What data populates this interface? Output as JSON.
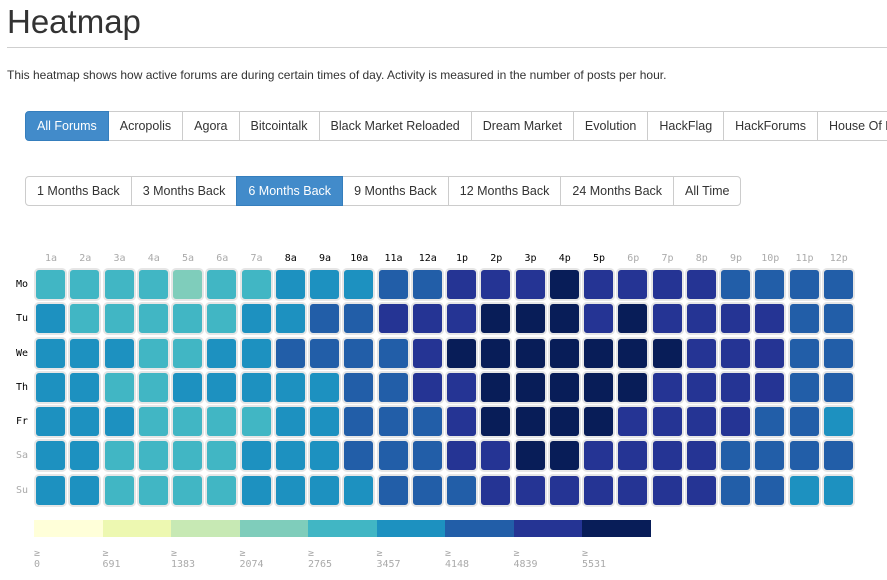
{
  "page": {
    "title": "Heatmap",
    "description": "This heatmap shows how active forums are during certain times of day. Activity is measured in the number of posts per hour."
  },
  "forum_tabs": {
    "active": "All Forums",
    "items": [
      "All Forums",
      "Acropolis",
      "Agora",
      "Bitcointalk",
      "Black Market Reloaded",
      "Dream Market",
      "Evolution",
      "HackFlag",
      "HackForums",
      "House Of Lions",
      ""
    ]
  },
  "range_tabs": {
    "active": "6 Months Back",
    "items": [
      "1 Months Back",
      "3 Months Back",
      "6 Months Back",
      "9 Months Back",
      "12 Months Back",
      "24 Months Back",
      "All Time"
    ]
  },
  "colors": {
    "active_button": "#428bca",
    "scale": [
      "#ffffd9",
      "#edf8b1",
      "#c7e9b4",
      "#7fcdbb",
      "#41b6c4",
      "#1d91c0",
      "#225ea8",
      "#253494",
      "#081d58"
    ]
  },
  "chart_data": {
    "type": "heatmap",
    "title": "",
    "value_label": "posts per hour",
    "x_categories": [
      "1a",
      "2a",
      "3a",
      "4a",
      "5a",
      "6a",
      "7a",
      "8a",
      "9a",
      "10a",
      "11a",
      "12a",
      "1p",
      "2p",
      "3p",
      "4p",
      "5p",
      "6p",
      "7p",
      "8p",
      "9p",
      "10p",
      "11p",
      "12p"
    ],
    "x_highlighted": [
      "8a",
      "9a",
      "10a",
      "11a",
      "12a",
      "1p",
      "2p",
      "3p",
      "4p",
      "5p"
    ],
    "y_categories": [
      "Mo",
      "Tu",
      "We",
      "Th",
      "Fr",
      "Sa",
      "Su"
    ],
    "y_highlighted": [
      "Mo",
      "Tu",
      "We",
      "Th",
      "Fr"
    ],
    "legend": {
      "thresholds": [
        0,
        691,
        1383,
        2074,
        2765,
        3457,
        4148,
        4839,
        5531
      ],
      "labels": [
        "≥ 0",
        "≥ 691",
        "≥ 1383",
        "≥ 2074",
        "≥ 2765",
        "≥ 3457",
        "≥ 4148",
        "≥ 4839",
        "≥ 5531"
      ],
      "placement": "bottom-left"
    },
    "bin_note": "values given as lower bound of the legend bin each cell falls into",
    "values": [
      [
        2765,
        2765,
        2765,
        2765,
        2074,
        2765,
        2765,
        3457,
        3457,
        3457,
        4148,
        4148,
        4839,
        4839,
        4839,
        5531,
        4839,
        4839,
        4839,
        4839,
        4148,
        4148,
        4148,
        4148
      ],
      [
        3457,
        2765,
        2765,
        2765,
        2765,
        2765,
        3457,
        3457,
        4148,
        4148,
        4839,
        4839,
        4839,
        5531,
        5531,
        5531,
        4839,
        5531,
        4839,
        4839,
        4839,
        4839,
        4148,
        4148
      ],
      [
        3457,
        3457,
        3457,
        2765,
        2765,
        3457,
        3457,
        4148,
        4148,
        4148,
        4148,
        4839,
        5531,
        5531,
        5531,
        5531,
        5531,
        5531,
        5531,
        4839,
        4839,
        4839,
        4148,
        4148
      ],
      [
        3457,
        3457,
        2765,
        2765,
        3457,
        3457,
        3457,
        3457,
        3457,
        4148,
        4148,
        4839,
        4839,
        5531,
        5531,
        5531,
        5531,
        5531,
        4839,
        4839,
        4839,
        4839,
        4148,
        4148
      ],
      [
        3457,
        3457,
        3457,
        2765,
        2765,
        2765,
        2765,
        3457,
        3457,
        4148,
        4148,
        4148,
        4839,
        5531,
        5531,
        5531,
        5531,
        4839,
        4839,
        4839,
        4839,
        4148,
        4148,
        3457
      ],
      [
        3457,
        3457,
        2765,
        2765,
        2765,
        2765,
        3457,
        3457,
        3457,
        4148,
        4148,
        4148,
        4839,
        4839,
        5531,
        5531,
        4839,
        4839,
        4839,
        4839,
        4148,
        4148,
        4148,
        4148
      ],
      [
        3457,
        3457,
        2765,
        2765,
        2765,
        2765,
        3457,
        3457,
        3457,
        3457,
        4148,
        4148,
        4148,
        4839,
        4839,
        4839,
        4839,
        4839,
        4839,
        4839,
        4148,
        4148,
        3457,
        3457
      ]
    ]
  }
}
